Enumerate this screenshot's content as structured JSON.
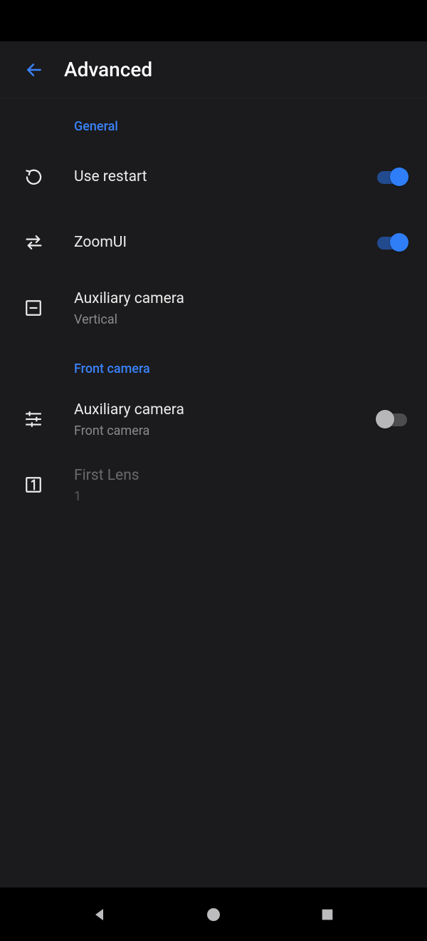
{
  "header": {
    "title": "Advanced"
  },
  "sections": {
    "general": {
      "label": "General"
    },
    "front": {
      "label": "Front camera"
    }
  },
  "items": {
    "use_restart": {
      "title": "Use restart",
      "toggle": "on"
    },
    "zoom_ui": {
      "title": "ZoomUI",
      "toggle": "on"
    },
    "aux_cam": {
      "title": "Auxiliary camera",
      "subtitle": "Vertical"
    },
    "front_aux": {
      "title": "Auxiliary camera",
      "subtitle": "Front camera",
      "toggle": "off"
    },
    "first_lens": {
      "title": "First Lens",
      "subtitle": "1",
      "disabled": true
    }
  },
  "colors": {
    "accent": "#3a82f7",
    "bg": "#1b1b1d",
    "text": "#ececec",
    "text_secondary": "#8a8a8d"
  }
}
